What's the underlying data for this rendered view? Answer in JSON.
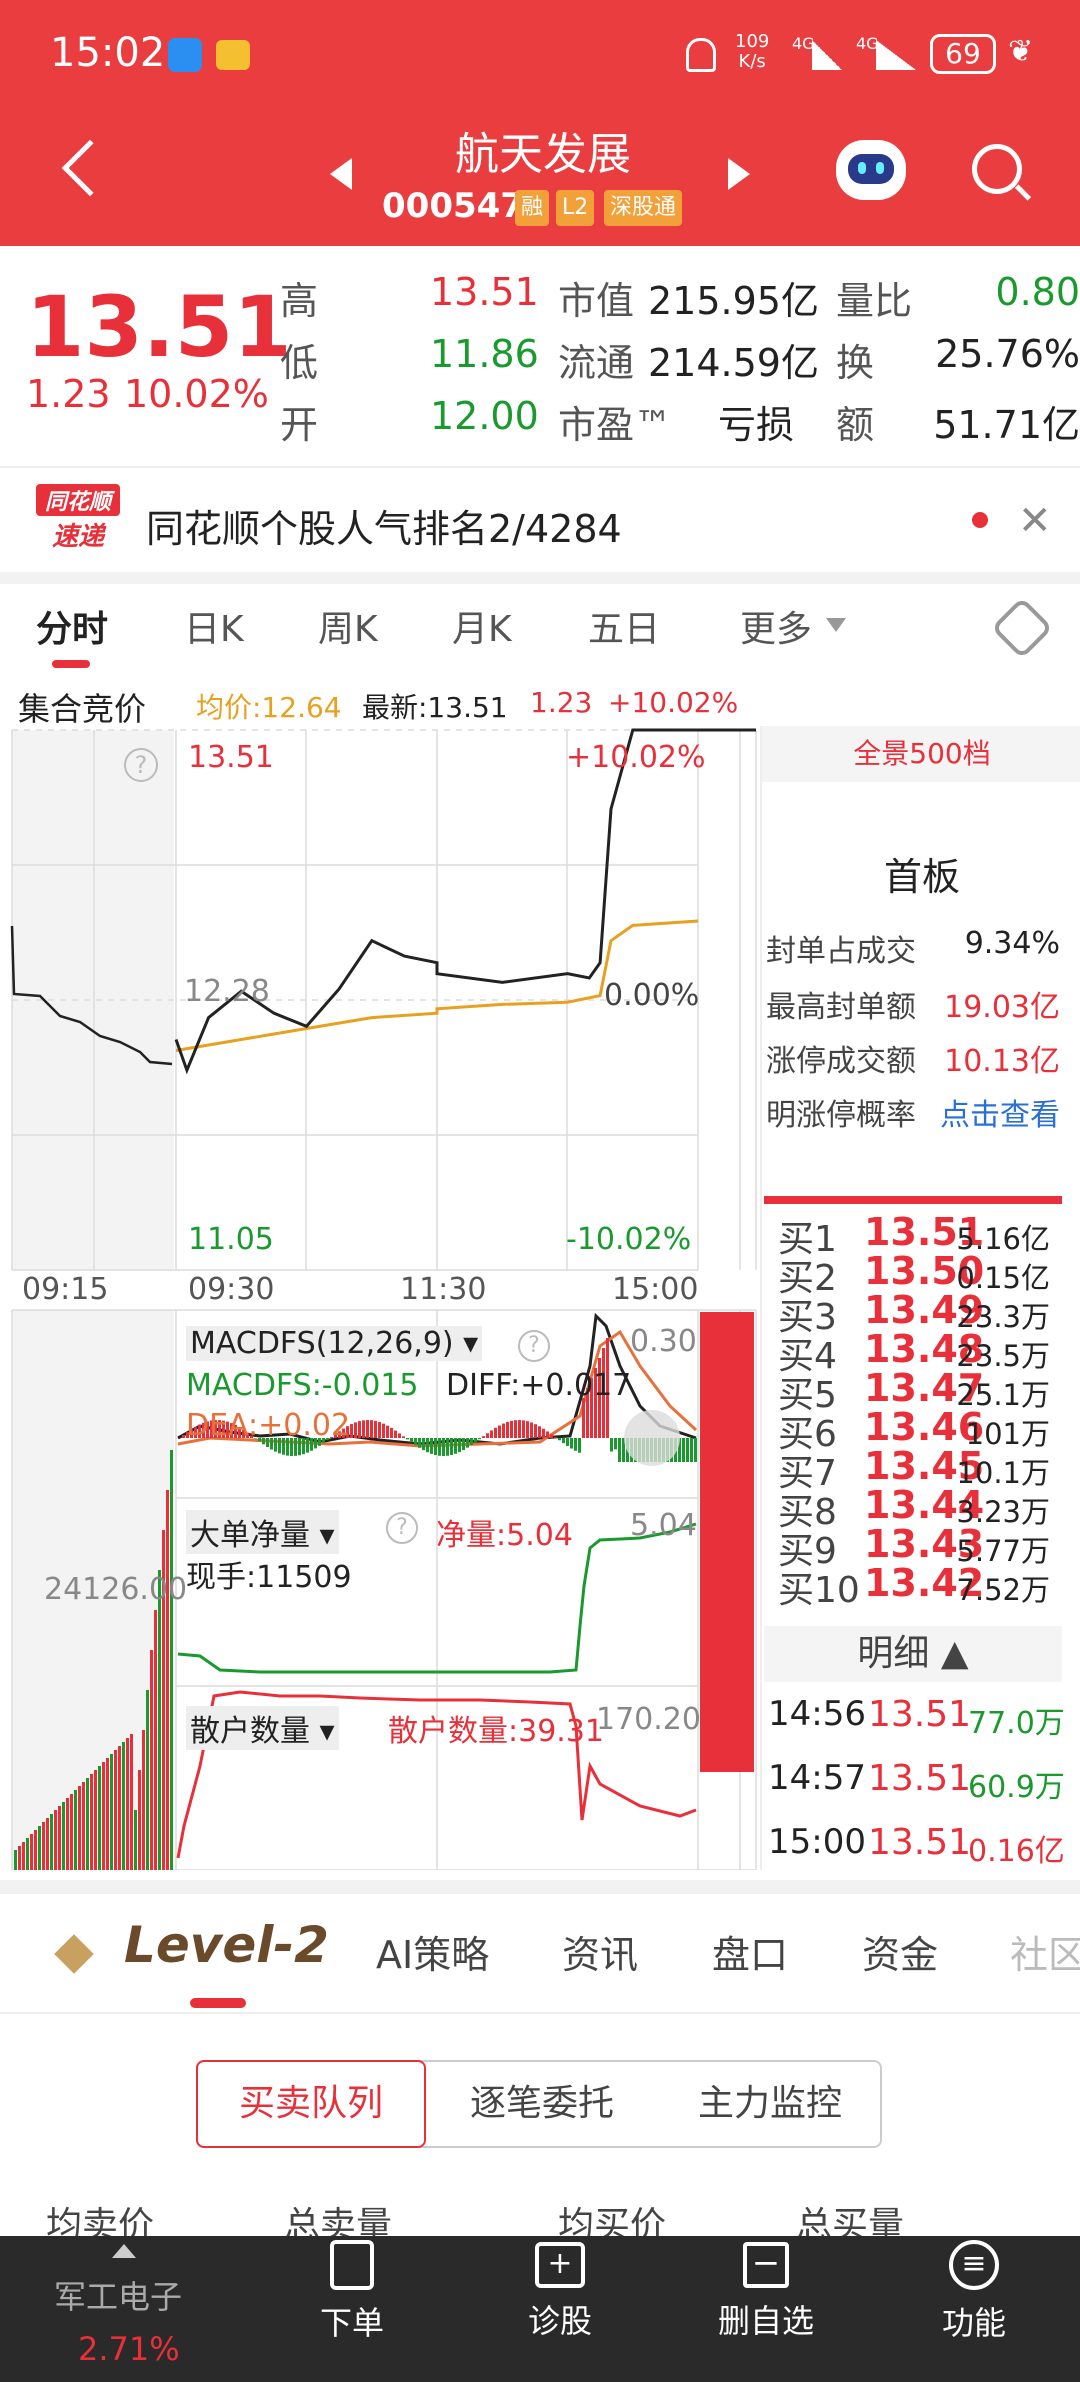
{
  "status_bar": {
    "time": "15:02",
    "net_speed_top": "109",
    "net_speed_bottom": "K/s",
    "signal1": "4G",
    "signal2": "4G",
    "battery": "69"
  },
  "header": {
    "stock_name": "航天发展",
    "stock_code": "000547",
    "tags": [
      "融",
      "L2",
      "深股通"
    ]
  },
  "quote": {
    "price": "13.51",
    "change": "1.23",
    "change_pct": "10.02%",
    "high_label": "高",
    "high": "13.51",
    "low_label": "低",
    "low": "11.86",
    "open_label": "开",
    "open": "12.00",
    "mkt_cap_label": "市值",
    "mkt_cap": "215.95亿",
    "float_label": "流通",
    "float_cap": "214.59亿",
    "pe_label": "市盈™",
    "pe": "亏损",
    "vol_ratio_label": "量比",
    "vol_ratio": "0.80",
    "turnover_label": "换",
    "turnover": "25.76%",
    "amount_label": "额",
    "amount": "51.71亿"
  },
  "news": {
    "logo_line1": "同花顺",
    "logo_line2": "速递",
    "text": "同花顺个股人气排名2/4284"
  },
  "chart_tabs": [
    "分时",
    "日K",
    "周K",
    "月K",
    "五日",
    "更多"
  ],
  "chart_header": {
    "auction": "集合竞价",
    "avg": "均价:12.64",
    "latest": "最新:13.51",
    "chg": "1.23",
    "chg_pct": "+10.02%"
  },
  "chart_data": {
    "type": "line",
    "title": "",
    "x_ticks": [
      "09:15",
      "09:30",
      "11:30",
      "15:00"
    ],
    "y_left": {
      "top": "13.51",
      "mid": "12.28",
      "bottom": "11.05"
    },
    "y_right": {
      "top": "+10.02%",
      "mid": "0.00%",
      "bottom": "-10.02%"
    },
    "ylim": [
      11.05,
      13.51
    ],
    "series": [
      {
        "name": "最新",
        "x": [
          "09:30",
          "09:35",
          "09:45",
          "10:00",
          "10:15",
          "10:30",
          "10:45",
          "11:00",
          "11:15",
          "11:30",
          "13:00",
          "13:30",
          "14:00",
          "14:10",
          "14:15",
          "14:20",
          "14:30",
          "14:45",
          "15:00"
        ],
        "y": [
          12.1,
          11.96,
          12.2,
          12.32,
          12.22,
          12.16,
          12.33,
          12.55,
          12.48,
          12.45,
          12.4,
          12.36,
          12.4,
          12.38,
          12.45,
          13.15,
          13.51,
          13.51,
          13.51
        ]
      },
      {
        "name": "均价",
        "x": [
          "09:30",
          "10:00",
          "10:30",
          "11:00",
          "11:30",
          "13:00",
          "13:30",
          "14:00",
          "14:15",
          "14:20",
          "14:30",
          "15:00"
        ],
        "y": [
          12.05,
          12.1,
          12.15,
          12.2,
          12.22,
          12.24,
          12.26,
          12.27,
          12.3,
          12.55,
          12.62,
          12.64
        ]
      }
    ],
    "macd_label": "MACDFS(12,26,9)",
    "macd_val": "MACDFS:-0.015",
    "diff": "DIFF:+0.017",
    "dea": "DEA:+0.02",
    "macd_max": "0.30",
    "big_order_label": "大单净量",
    "big_order_val": "净量:5.04",
    "big_order_max": "5.04",
    "volume": "现手:11509",
    "auction_vol": "24126.00",
    "retail_label": "散户数量",
    "retail_val": "散户数量:39.31",
    "retail_max": "170.20"
  },
  "side_panel": {
    "banner": "全景500档",
    "title": "首板",
    "rows": [
      {
        "label": "封单占成交",
        "value": "9.34%"
      },
      {
        "label": "最高封单额",
        "value": "19.03亿"
      },
      {
        "label": "涨停成交额",
        "value": "10.13亿"
      },
      {
        "label": "明涨停概率",
        "value": "点击查看"
      }
    ]
  },
  "order_book": [
    {
      "label": "买1",
      "price": "13.51",
      "vol": "5.16亿"
    },
    {
      "label": "买2",
      "price": "13.50",
      "vol": "0.15亿"
    },
    {
      "label": "买3",
      "price": "13.49",
      "vol": "23.3万"
    },
    {
      "label": "买4",
      "price": "13.48",
      "vol": "23.5万"
    },
    {
      "label": "买5",
      "price": "13.47",
      "vol": "25.1万"
    },
    {
      "label": "买6",
      "price": "13.46",
      "vol": "101万"
    },
    {
      "label": "买7",
      "price": "13.45",
      "vol": "10.1万"
    },
    {
      "label": "买8",
      "price": "13.44",
      "vol": "3.23万"
    },
    {
      "label": "买9",
      "price": "13.43",
      "vol": "5.77万"
    },
    {
      "label": "买10",
      "price": "13.42",
      "vol": "7.52万"
    }
  ],
  "trades": {
    "title": "明细",
    "rows": [
      {
        "time": "14:56",
        "price": "13.51",
        "vol": "77.0万"
      },
      {
        "time": "14:57",
        "price": "13.51",
        "vol": "60.9万"
      },
      {
        "time": "15:00",
        "price": "13.51",
        "vol": "0.16亿"
      }
    ]
  },
  "sub_tabs": {
    "level2": "Level-2",
    "items": [
      "AI策略",
      "资讯",
      "盘口",
      "资金",
      "社区"
    ]
  },
  "segment": [
    "买卖队列",
    "逐笔委托",
    "主力监控"
  ],
  "table_headers": [
    "均卖价",
    "总卖量",
    "均买价",
    "总买量"
  ],
  "bottom_nav": {
    "index_name": "军工电子",
    "index_pct": "2.71%",
    "items": [
      "下单",
      "诊股",
      "删自选",
      "功能"
    ]
  },
  "colors": {
    "red": "#ea3d3f",
    "green": "#1a9a2e",
    "orange": "#e8a020",
    "blue": "#2a6fd6"
  }
}
